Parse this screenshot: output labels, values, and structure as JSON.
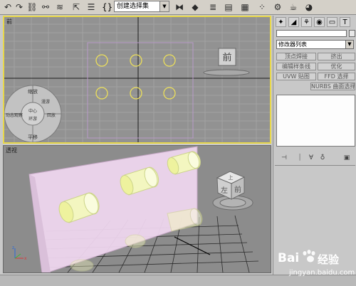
{
  "toolbar": {
    "selection_set": "创建选择集",
    "braces": "{}",
    "icons": [
      "undo-icon",
      "redo-icon",
      "link-icon",
      "unlink-icon",
      "bind-space-warp-icon",
      "select-icon",
      "select-by-name-icon",
      "rect-select-icon",
      "window-crossing-icon",
      "move-icon",
      "rotate-icon",
      "scale-icon",
      "mirror-icon",
      "align-icon",
      "layers-icon",
      "curve-editor-icon",
      "schematic-icon",
      "material-editor-icon",
      "render-scene-icon",
      "quick-render-icon"
    ]
  },
  "viewports": {
    "top": {
      "label": "前",
      "viewcube_face": "前",
      "nav": {
        "zoom": "缩放",
        "orbit": "动态观察",
        "center": "中心",
        "rewind": "回放",
        "pan": "平移",
        "look": "环游",
        "walk": "漫游"
      }
    },
    "perspective": {
      "label": "透视",
      "viewcube_face_top": "上",
      "viewcube_face_left": "左",
      "viewcube_face_front": "前"
    }
  },
  "command_panel": {
    "tabs": [
      "create-tab",
      "modify-tab",
      "hierarchy-tab",
      "motion-tab",
      "display-tab",
      "utilities-tab"
    ],
    "tab_glyphs": [
      "✦",
      "◢",
      "⚘",
      "◉",
      "▭",
      "T"
    ],
    "modifier_list": "修改器列表",
    "modifier_buttons": [
      {
        "label": "顶点焊接"
      },
      {
        "label": "挤出"
      },
      {
        "label": "编辑样条线"
      },
      {
        "label": "优化"
      },
      {
        "label": "UVW 贴图"
      },
      {
        "label": "FFD 选择"
      },
      {
        "label": "NURBS 曲面选择"
      }
    ],
    "stack_buttons": [
      "pin-stack-icon",
      "show-end-result-icon",
      "make-unique-icon",
      "remove-modifier-icon",
      "configure-sets-icon"
    ]
  },
  "watermark": {
    "logo": "Bai",
    "brand": "经验",
    "url": "jingyan.baidu.com"
  },
  "colors": {
    "active_border": "#e8d84a",
    "viewport_bg": "#929292",
    "plane": "#f1d8f1",
    "cylinder": "#f1f5b8",
    "circle": "#ede05a"
  }
}
